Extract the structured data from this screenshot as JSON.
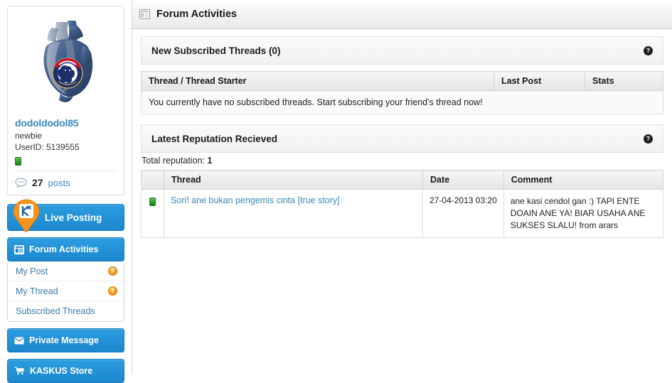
{
  "sidebar": {
    "profile": {
      "avatar_alt": "chelsea-heart-avatar",
      "username": "dodoldodol85",
      "usertitle": "newbie",
      "userid_label": "UserID: 5139555",
      "reputation_icon": "green-cendol-bar",
      "posts_count": "27",
      "posts_label": "posts",
      "posts_icon": "speech-bubble-icon"
    },
    "nav": {
      "live_posting": {
        "label": "Live Posting",
        "icon": "kaskus-pin-icon"
      },
      "forum_activities": {
        "label": "Forum Activities",
        "icon": "layout-window-icon"
      },
      "sub_items": [
        {
          "label": "My Post",
          "badge": "?"
        },
        {
          "label": "My Thread",
          "badge": "?"
        },
        {
          "label": "Subscribed Threads",
          "badge": ""
        }
      ],
      "private_message": {
        "label": "Private Message",
        "icon": "envelope-icon"
      },
      "kaskus_store": {
        "label": "KASKUS Store",
        "icon": "shopping-cart-icon"
      }
    }
  },
  "main": {
    "header": {
      "title": "Forum Activities",
      "icon": "layout-window-icon"
    },
    "subscribed_panel": {
      "title": "New Subscribed Threads (0)",
      "help": "?",
      "columns": [
        "Thread / Thread Starter",
        "Last Post",
        "Stats"
      ],
      "empty_message": "You currently have no subscribed threads. Start subscribing your friend's thread now!"
    },
    "reputation_panel": {
      "title": "Latest Reputation Recieved",
      "help": "?",
      "total_label": "Total reputation:",
      "total_value": "1",
      "columns": [
        "Thread",
        "Date",
        "Comment"
      ],
      "rows": [
        {
          "icon": "green-cendol-bar",
          "thread": "Sori! ane bukan pengemis cinta [true story]",
          "date": "27-04-2013 03:20",
          "comment": "ane kasi cendol gan :) TAPI ENTE DOAIN ANE YA! BIAR USAHA ANE SUKSES SLALU! from arars"
        }
      ]
    }
  },
  "colors": {
    "brand_blue": "#1c87cd",
    "link_blue": "#3a87bf",
    "accent_orange": "#f49a1a",
    "cendol_green": "#2ea02e"
  }
}
